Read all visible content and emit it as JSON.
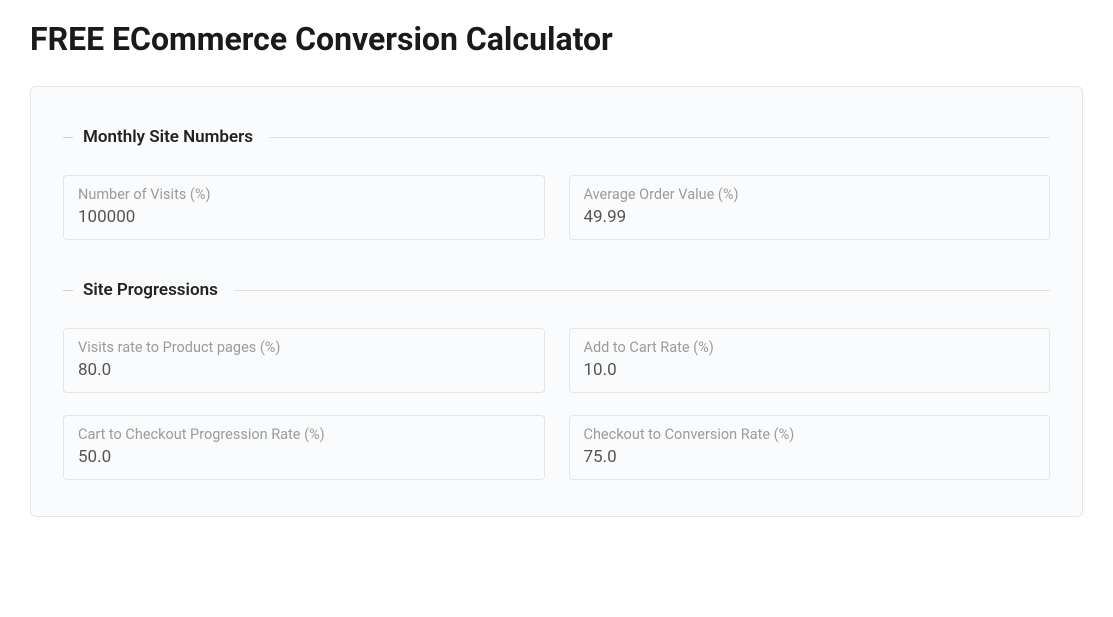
{
  "page": {
    "title": "FREE ECommerce Conversion Calculator"
  },
  "sections": {
    "monthly": {
      "title": "Monthly Site Numbers",
      "fields": {
        "visits": {
          "label": "Number of Visits (%)",
          "value": "100000"
        },
        "aov": {
          "label": "Average Order Value (%)",
          "value": "49.99"
        }
      }
    },
    "progressions": {
      "title": "Site Progressions",
      "fields": {
        "visitsToProduct": {
          "label": "Visits rate to Product pages (%)",
          "value": "80.0"
        },
        "addToCart": {
          "label": "Add to Cart Rate (%)",
          "value": "10.0"
        },
        "cartToCheckout": {
          "label": "Cart to Checkout Progression Rate (%)",
          "value": "50.0"
        },
        "checkoutToConversion": {
          "label": "Checkout to Conversion Rate (%)",
          "value": "75.0"
        }
      }
    }
  }
}
